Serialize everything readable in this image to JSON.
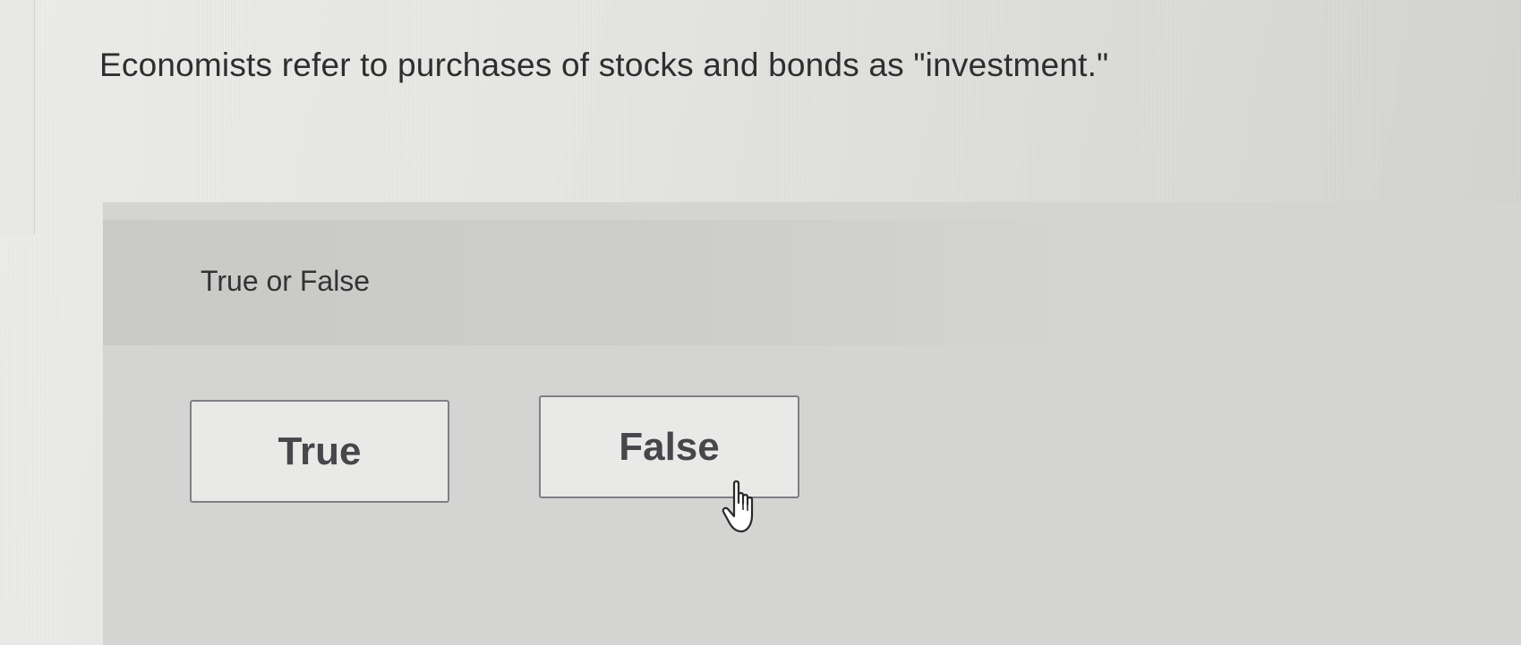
{
  "question": {
    "text": "Economists refer to purchases of stocks and bonds as \"investment.\""
  },
  "prompt": {
    "text": "True or False"
  },
  "choices": [
    {
      "label": "True"
    },
    {
      "label": "False"
    }
  ],
  "cursor": {
    "icon": "hand-pointer-icon",
    "hovering": "False"
  }
}
